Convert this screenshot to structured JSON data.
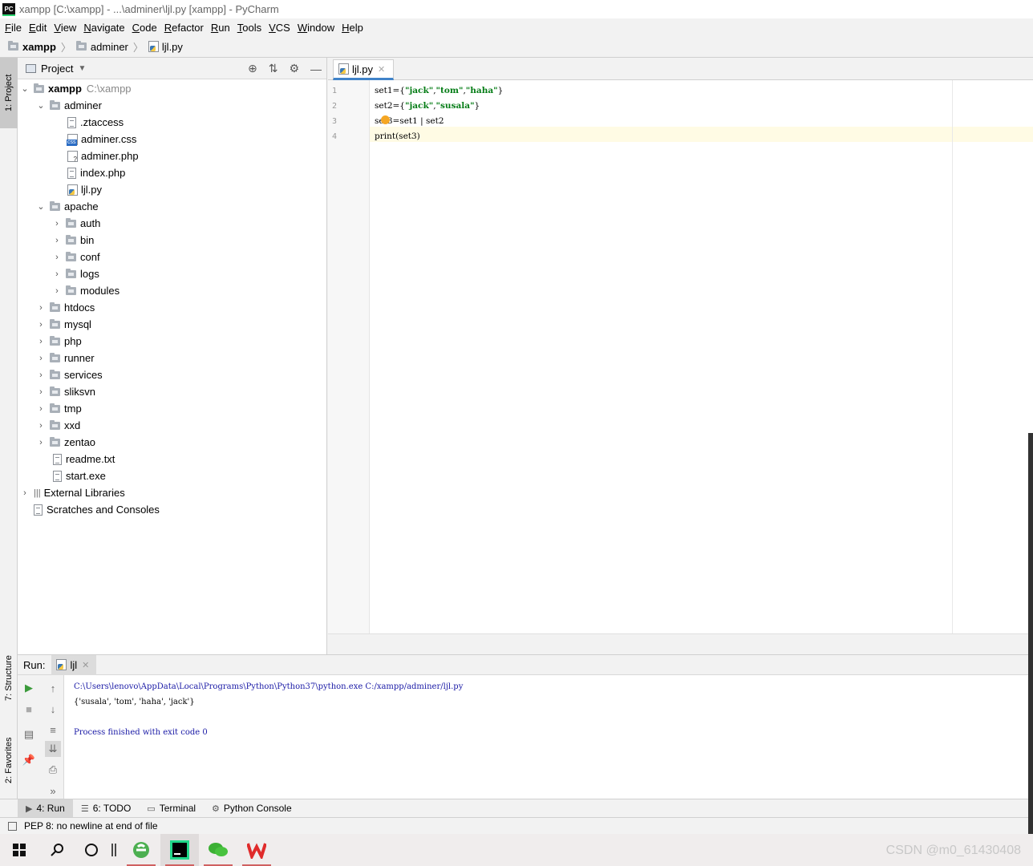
{
  "window": {
    "title": "xampp [C:\\xampp] - ...\\adminer\\ljl.py [xampp] - PyCharm",
    "logo": "PC"
  },
  "menu": [
    "File",
    "Edit",
    "View",
    "Navigate",
    "Code",
    "Refactor",
    "Run",
    "Tools",
    "VCS",
    "Window",
    "Help"
  ],
  "breadcrumb": [
    "xampp",
    "adminer",
    "ljl.py"
  ],
  "sidebar_tabs": {
    "project": "1: Project",
    "structure": "7: Structure",
    "favorites": "2: Favorites"
  },
  "project": {
    "header": "Project",
    "root_name": "xampp",
    "root_path": "C:\\xampp",
    "adminer": "adminer",
    "adminer_files": [
      ".ztaccess",
      "adminer.css",
      "adminer.php",
      "index.php",
      "ljl.py"
    ],
    "apache": "apache",
    "apache_dirs": [
      "auth",
      "bin",
      "conf",
      "logs",
      "modules"
    ],
    "dirs": [
      "htdocs",
      "mysql",
      "php",
      "runner",
      "services",
      "sliksvn",
      "tmp",
      "xxd",
      "zentao"
    ],
    "files": [
      "readme.txt",
      "start.exe"
    ],
    "external": "External Libraries",
    "scratches": "Scratches and Consoles"
  },
  "editor": {
    "tab": "ljl.py",
    "line_numbers": [
      "1",
      "2",
      "3",
      "4"
    ],
    "lines": [
      {
        "pre": "set1={",
        "s1": "\"jack\"",
        "c1": ",",
        "s2": "\"tom\"",
        "c2": ",",
        "s3": "\"haha\"",
        "post": "}"
      },
      {
        "pre": "set2={",
        "s1": "\"jack\"",
        "c1": ",",
        "s2": "\"susala\"",
        "post": "}"
      },
      {
        "text": "set3=set1 | set2"
      },
      {
        "text": "print(set3)"
      }
    ]
  },
  "run": {
    "label": "Run:",
    "tab": "ljl",
    "console": [
      "C:\\Users\\lenovo\\AppData\\Local\\Programs\\Python\\Python37\\python.exe C:/xampp/adminer/ljl.py",
      "{'susala', 'tom', 'haha', 'jack'}",
      "",
      "Process finished with exit code 0"
    ]
  },
  "bottom_tabs": [
    "4: Run",
    "6: TODO",
    "Terminal",
    "Python Console"
  ],
  "status": "PEP 8: no newline at end of file",
  "watermark": "CSDN @m0_61430408"
}
